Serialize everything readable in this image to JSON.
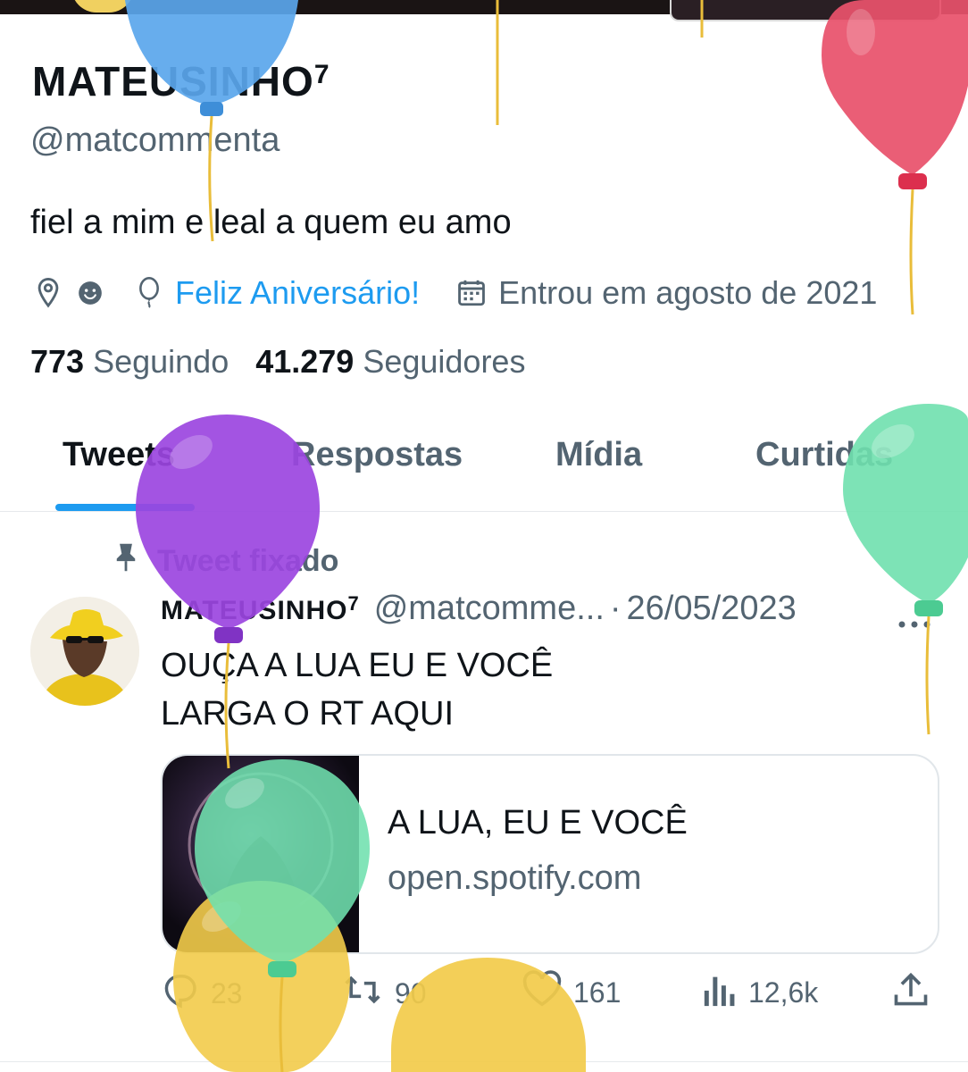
{
  "profile": {
    "display_name": "MATEUSINHO",
    "display_name_sup": "7",
    "handle": "@matcommenta",
    "bio": "fiel a mim e leal a quem eu amo",
    "location_icon": "location-pin-icon",
    "location_emoji": "smiley-icon",
    "birthday_icon": "balloon-icon",
    "birthday_label": "Feliz Aniversário!",
    "joined_icon": "calendar-icon",
    "joined_label": "Entrou em agosto de 2021",
    "following_count": "773",
    "following_label": "Seguindo",
    "followers_count": "41.279",
    "followers_label": "Seguidores"
  },
  "tabs": [
    {
      "label": "Tweets",
      "active": true
    },
    {
      "label": "Respostas",
      "active": false
    },
    {
      "label": "Mídia",
      "active": false
    },
    {
      "label": "Curtidas",
      "active": false
    }
  ],
  "pinned": {
    "icon": "pin-icon",
    "label": "Tweet fixado"
  },
  "tweet": {
    "author_name": "MATEUSINHO",
    "author_name_sup": "7",
    "author_handle": "@matcomme...",
    "separator": "·",
    "date": "26/05/2023",
    "more_icon": "more-dots-icon",
    "text_lines": [
      "OUÇA A LUA EU E VOCÊ",
      "LARGA O RT AQUI"
    ],
    "card": {
      "title": "A LUA, EU E VOCÊ",
      "domain": "open.spotify.com"
    },
    "actions": {
      "reply_icon": "reply-icon",
      "replies": "23",
      "retweet_icon": "retweet-icon",
      "retweets": "90",
      "like_icon": "heart-icon",
      "likes": "161",
      "views_icon": "views-chart-icon",
      "views": "12,6k",
      "share_icon": "share-icon"
    }
  },
  "colors": {
    "accent": "#1d9bf0",
    "text_primary": "#0f1419",
    "text_secondary": "#536471",
    "balloon_blue": "#5aa6ec",
    "balloon_red": "#e8526c",
    "balloon_purple": "#9b45e0",
    "balloon_green": "#6fe0ae",
    "balloon_yellow": "#f2cb4a"
  }
}
